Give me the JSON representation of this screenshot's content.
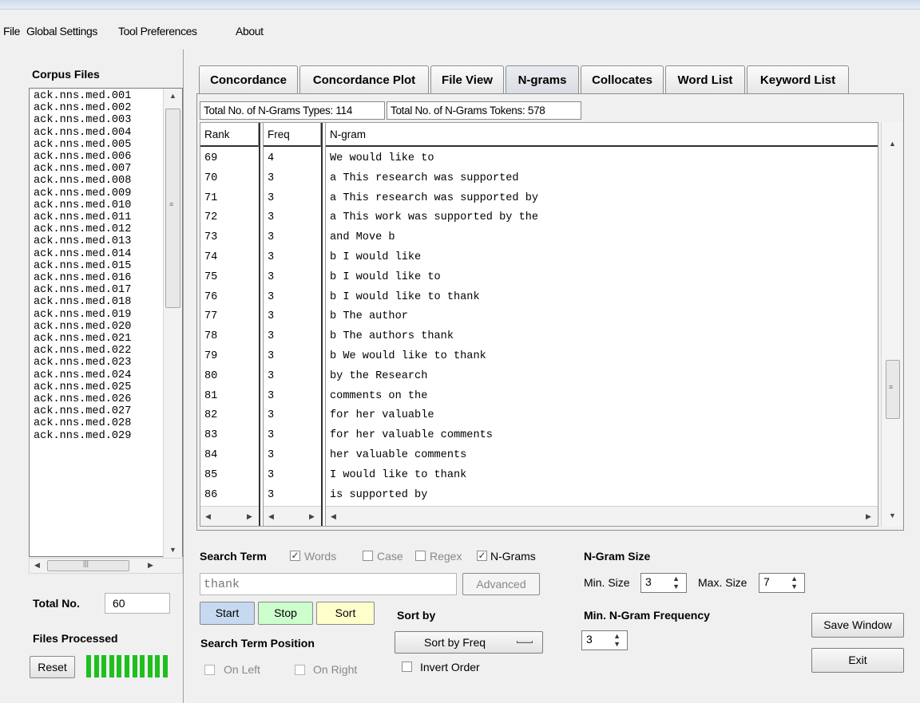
{
  "menu": [
    "File",
    "Global Settings",
    "Tool Preferences",
    "About"
  ],
  "left": {
    "corpus_title": "Corpus Files",
    "files": [
      "ack.nns.med.001",
      "ack.nns.med.002",
      "ack.nns.med.003",
      "ack.nns.med.004",
      "ack.nns.med.005",
      "ack.nns.med.006",
      "ack.nns.med.007",
      "ack.nns.med.008",
      "ack.nns.med.009",
      "ack.nns.med.010",
      "ack.nns.med.011",
      "ack.nns.med.012",
      "ack.nns.med.013",
      "ack.nns.med.014",
      "ack.nns.med.015",
      "ack.nns.med.016",
      "ack.nns.med.017",
      "ack.nns.med.018",
      "ack.nns.med.019",
      "ack.nns.med.020",
      "ack.nns.med.021",
      "ack.nns.med.022",
      "ack.nns.med.023",
      "ack.nns.med.024",
      "ack.nns.med.025",
      "ack.nns.med.026",
      "ack.nns.med.027",
      "ack.nns.med.028",
      "ack.nns.med.029"
    ],
    "total_label": "Total No.",
    "total_value": "60",
    "files_processed_label": "Files Processed",
    "reset_label": "Reset",
    "progress_fraction": 1.0
  },
  "tabs": [
    {
      "label": "Concordance",
      "active": false
    },
    {
      "label": "Concordance Plot",
      "active": false
    },
    {
      "label": "File View",
      "active": false
    },
    {
      "label": "N-grams",
      "active": true
    },
    {
      "label": "Collocates",
      "active": false
    },
    {
      "label": "Word List",
      "active": false
    },
    {
      "label": "Keyword List",
      "active": false
    }
  ],
  "stats": {
    "types": "Total No. of N-Grams Types: 114",
    "tokens": "Total No. of N-Grams Tokens: 578"
  },
  "table": {
    "headers": {
      "rank": "Rank",
      "freq": "Freq",
      "ngram": "N-gram"
    },
    "rows": [
      {
        "rank": "69",
        "freq": "4",
        "ngram": "We would like to"
      },
      {
        "rank": "70",
        "freq": "3",
        "ngram": "a This research was supported"
      },
      {
        "rank": "71",
        "freq": "3",
        "ngram": "a This research was supported by"
      },
      {
        "rank": "72",
        "freq": "3",
        "ngram": "a This work was supported by the"
      },
      {
        "rank": "73",
        "freq": "3",
        "ngram": "and Move b"
      },
      {
        "rank": "74",
        "freq": "3",
        "ngram": "b I would like"
      },
      {
        "rank": "75",
        "freq": "3",
        "ngram": "b I would like to"
      },
      {
        "rank": "76",
        "freq": "3",
        "ngram": "b I would like to thank"
      },
      {
        "rank": "77",
        "freq": "3",
        "ngram": "b The author"
      },
      {
        "rank": "78",
        "freq": "3",
        "ngram": "b The authors thank"
      },
      {
        "rank": "79",
        "freq": "3",
        "ngram": "b We would like to thank"
      },
      {
        "rank": "80",
        "freq": "3",
        "ngram": "by the Research"
      },
      {
        "rank": "81",
        "freq": "3",
        "ngram": "comments on the"
      },
      {
        "rank": "82",
        "freq": "3",
        "ngram": "for her valuable"
      },
      {
        "rank": "83",
        "freq": "3",
        "ngram": "for her valuable comments"
      },
      {
        "rank": "84",
        "freq": "3",
        "ngram": "her valuable comments"
      },
      {
        "rank": "85",
        "freq": "3",
        "ngram": "I would like to thank"
      },
      {
        "rank": "86",
        "freq": "3",
        "ngram": "is supported by"
      }
    ]
  },
  "search": {
    "label": "Search Term",
    "words_label": "Words",
    "words_checked": true,
    "case_label": "Case",
    "case_checked": false,
    "regex_label": "Regex",
    "regex_checked": false,
    "ngrams_label": "N-Grams",
    "ngrams_checked": true,
    "value": "thank",
    "advanced_label": "Advanced"
  },
  "controls": {
    "start_label": "Start",
    "stop_label": "Stop",
    "sort_label": "Sort",
    "sort_by_label": "Sort by",
    "sort_by_value": "Sort by Freq",
    "invert_label": "Invert Order",
    "position_label": "Search Term Position",
    "on_left_label": "On Left",
    "on_right_label": "On Right"
  },
  "ngram_size": {
    "title": "N-Gram Size",
    "min_label": "Min. Size",
    "min_value": "3",
    "max_label": "Max. Size",
    "max_value": "7",
    "freq_title": "Min. N-Gram Frequency",
    "freq_value": "3"
  },
  "actions": {
    "save_label": "Save Window",
    "exit_label": "Exit"
  },
  "colors": {
    "start": "#c6d9f1",
    "stop": "#ccffcc",
    "sort": "#ffffcc",
    "progress": "#1fbf1f"
  }
}
